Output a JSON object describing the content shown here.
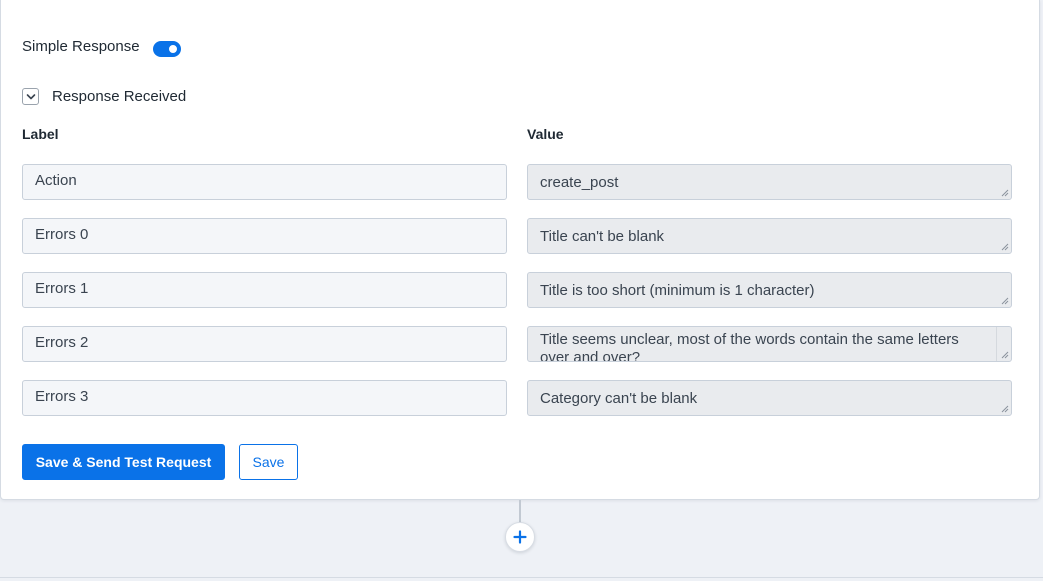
{
  "simple_response": {
    "label": "Simple Response",
    "enabled": true
  },
  "response_received": {
    "label": "Response Received",
    "expanded": true
  },
  "columns": {
    "label_header": "Label",
    "value_header": "Value"
  },
  "rows": [
    {
      "label": "Action",
      "value": "create_post"
    },
    {
      "label": "Errors 0",
      "value": "Title can't be blank"
    },
    {
      "label": "Errors 1",
      "value": "Title is too short (minimum is 1 character)"
    },
    {
      "label": "Errors 2",
      "value": "Title seems unclear, most of the words contain the same letters over and over?"
    },
    {
      "label": "Errors 3",
      "value": "Category can't be blank"
    }
  ],
  "buttons": {
    "primary": "Save & Send Test Request",
    "secondary": "Save"
  },
  "icons": {
    "collapse": "chevron-down-icon",
    "add": "plus-icon"
  },
  "colors": {
    "accent": "#0a72e8",
    "background": "#eef1f6"
  }
}
